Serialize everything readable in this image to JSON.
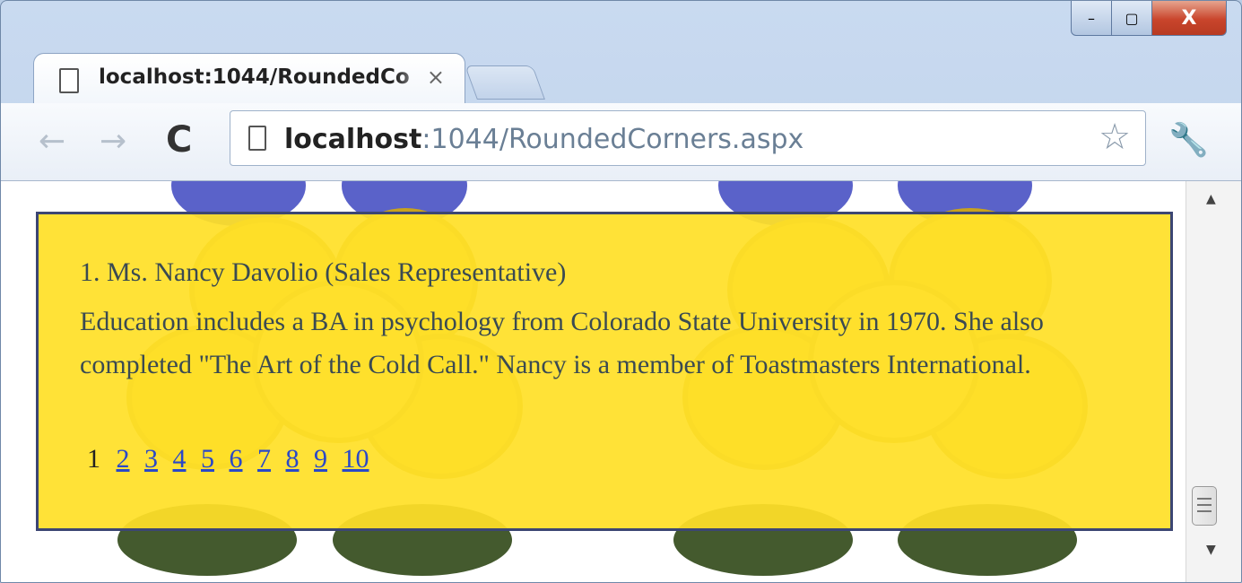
{
  "window": {
    "minimize_label": "–",
    "maximize_label": "▢",
    "close_label": "X"
  },
  "tab": {
    "title": "localhost:1044/RoundedCo",
    "close_label": "×"
  },
  "toolbar": {
    "back_label": "←",
    "forward_label": "→",
    "reload_label": "C",
    "url_host": "localhost",
    "url_rest": ":1044/RoundedCorners.aspx",
    "star_label": "☆",
    "wrench_label": "🔧"
  },
  "record": {
    "title": "1. Ms. Nancy Davolio (Sales Representative)",
    "body": "Education includes a BA in psychology from Colorado State University in 1970. She also completed \"The Art of the Cold Call.\" Nancy is a member of Toastmasters International."
  },
  "pager": {
    "current": "1",
    "links": [
      "2",
      "3",
      "4",
      "5",
      "6",
      "7",
      "8",
      "9",
      "10"
    ]
  },
  "colors": {
    "panel_background": "#ffe028",
    "panel_border": "#3c4673",
    "text": "#3a4a52",
    "link": "#2a48c8"
  }
}
